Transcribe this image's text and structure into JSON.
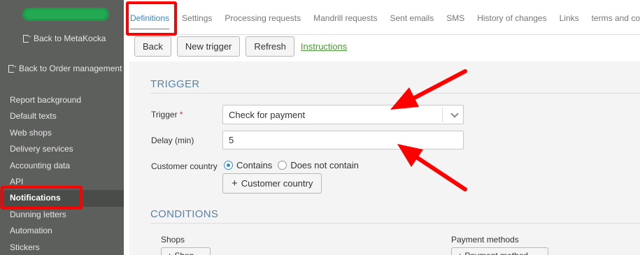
{
  "sidebar": {
    "back_metakocka": "Back to MetaKocka",
    "back_orders": "Back to Order management",
    "items": [
      {
        "label": "Report background"
      },
      {
        "label": "Default texts"
      },
      {
        "label": "Web shops"
      },
      {
        "label": "Delivery services"
      },
      {
        "label": "Accounting data"
      },
      {
        "label": "API"
      },
      {
        "label": "Notifications"
      },
      {
        "label": "Dunning letters"
      },
      {
        "label": "Automation"
      },
      {
        "label": "Stickers"
      }
    ]
  },
  "tabs": [
    {
      "label": "Definitions"
    },
    {
      "label": "Settings"
    },
    {
      "label": "Processing requests"
    },
    {
      "label": "Mandrill requests"
    },
    {
      "label": "Sent emails"
    },
    {
      "label": "SMS"
    },
    {
      "label": "History of changes"
    },
    {
      "label": "Links"
    },
    {
      "label": "terms and condi"
    }
  ],
  "toolbar": {
    "back": "Back",
    "new_trigger": "New trigger",
    "refresh": "Refresh",
    "instructions": "Instructions"
  },
  "trigger_section": {
    "title": "TRIGGER",
    "trigger_label": "Trigger",
    "required_mark": "*",
    "trigger_value": "Check for payment",
    "delay_label": "Delay (min)",
    "delay_value": "5",
    "country_label": "Customer country",
    "contains": "Contains",
    "not_contains": "Does not contain",
    "add_country": "Customer country"
  },
  "conditions_section": {
    "title": "CONDITIONS",
    "shops_label": "Shops",
    "shops_button": "+ Shop",
    "payment_label": "Payment methods",
    "payment_button": "+ Payment method"
  },
  "colors": {
    "sidebar": "#5d5f5d",
    "highlight": "#ff0000",
    "accent": "#3b86c9",
    "link": "#4c9a3b",
    "section_title": "#5a82a5"
  }
}
